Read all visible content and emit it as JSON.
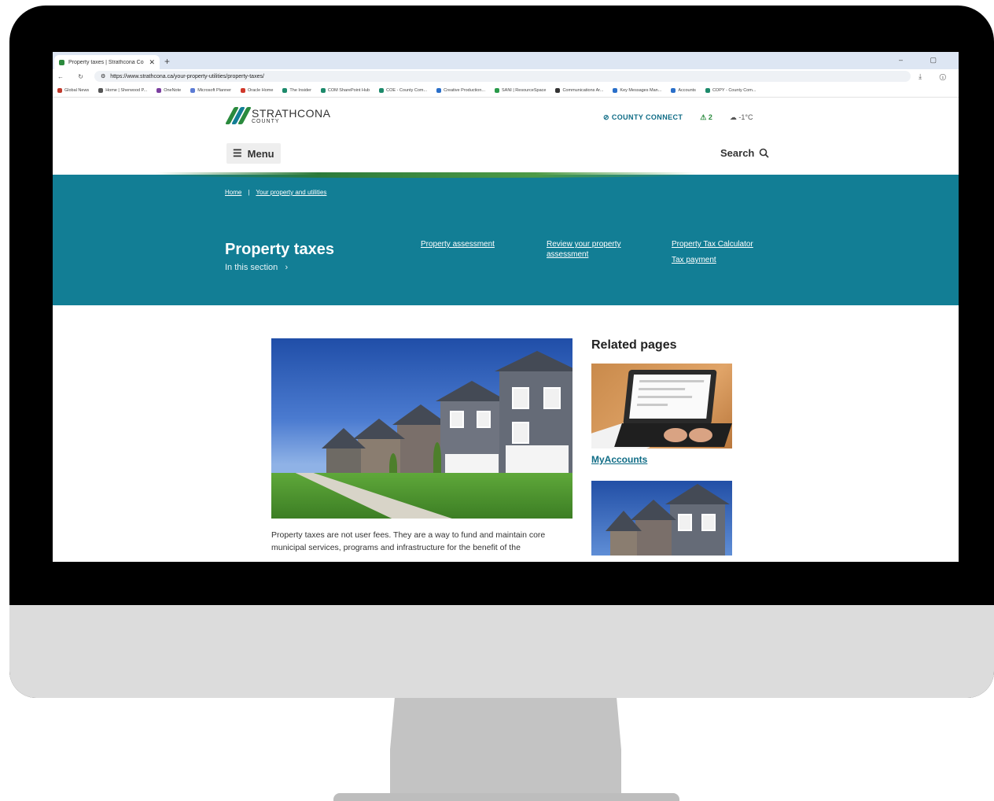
{
  "browser": {
    "tab_title": "Property taxes | Strathcona Co",
    "tab_close": "✕",
    "new_tab": "+",
    "window_controls": "–  ▢",
    "nav_icons": "← ↻",
    "url": "https://www.strathcona.ca/your-property-utilities/property-taxes/",
    "addr_icons": "⤓ ⓘ",
    "bookmarks": [
      {
        "label": "Global News",
        "color": "#c0392b"
      },
      {
        "label": "Home | Sherwood P...",
        "color": "#555555"
      },
      {
        "label": "OneNote",
        "color": "#7b3fa0"
      },
      {
        "label": "Microsoft Planner",
        "color": "#5b7bd5"
      },
      {
        "label": "Oracle Home",
        "color": "#d0392b"
      },
      {
        "label": "The Insider",
        "color": "#1d8a6b"
      },
      {
        "label": "COM SharePoint Hub",
        "color": "#1d8a6b"
      },
      {
        "label": "COE - County Com...",
        "color": "#1d8a6b"
      },
      {
        "label": "Creative Production...",
        "color": "#2a6fc9"
      },
      {
        "label": "SANI | ResourceSpace",
        "color": "#2a9a4a"
      },
      {
        "label": "Communications Ar...",
        "color": "#333333"
      },
      {
        "label": "Key Messages Man...",
        "color": "#2a6fc9"
      },
      {
        "label": "Accounts",
        "color": "#2a6fc9"
      },
      {
        "label": "COPY - County Com...",
        "color": "#1d8a6b"
      }
    ]
  },
  "header": {
    "logo_name": "STRATHCONA",
    "logo_sub": "COUNTY",
    "county_connect": "COUNTY CONNECT",
    "alerts_count": "2",
    "weather": "-1°C",
    "menu_label": "Menu",
    "search_label": "Search"
  },
  "banner": {
    "breadcrumbs": [
      "Home",
      "Your property and utilities"
    ],
    "breadcrumb_sep": "|",
    "title": "Property taxes",
    "in_section": "In this section",
    "links": [
      "Property assessment",
      "Review your property assessment",
      "Property Tax Calculator",
      "Tax payment"
    ]
  },
  "content": {
    "body_text": "Property taxes are not user fees. They are a way to fund and maintain core municipal services, programs and infrastructure for the benefit of the",
    "related_title": "Related pages",
    "related_links": [
      "MyAccounts"
    ]
  },
  "colors": {
    "banner": "#127e95",
    "link": "#0f6c86",
    "logo_green": "#2a8a3d",
    "logo_teal": "#127e95"
  }
}
